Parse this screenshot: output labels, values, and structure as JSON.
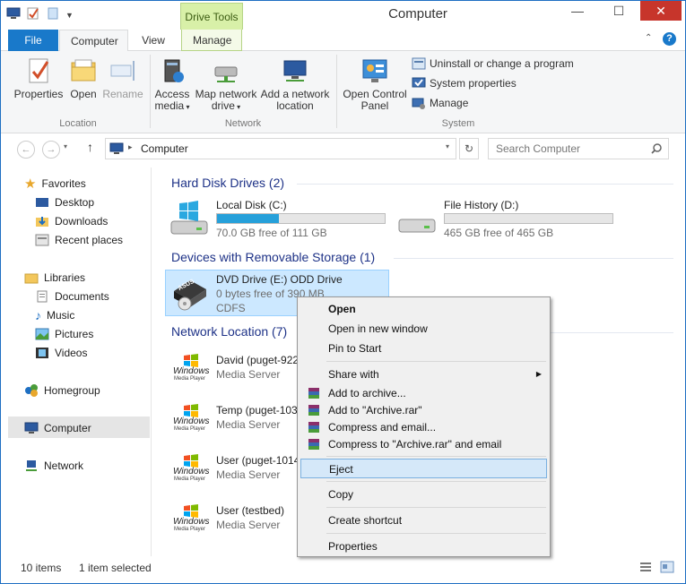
{
  "window": {
    "title": "Computer",
    "context_tab": "Drive Tools",
    "minimize": "—",
    "maximize": "☐",
    "close": "✕"
  },
  "tabs": {
    "file": "File",
    "computer": "Computer",
    "view": "View",
    "manage": "Manage"
  },
  "ribbon": {
    "location": {
      "label": "Location",
      "properties": "Properties",
      "open": "Open",
      "rename": "Rename"
    },
    "network": {
      "label": "Network",
      "access_media_1": "Access",
      "access_media_2": "media",
      "map_drive_1": "Map network",
      "map_drive_2": "drive",
      "add_location_1": "Add a network",
      "add_location_2": "location"
    },
    "system": {
      "label": "System",
      "control_panel_1": "Open Control",
      "control_panel_2": "Panel",
      "uninstall": "Uninstall or change a program",
      "system_properties": "System properties",
      "manage": "Manage"
    }
  },
  "address": {
    "path": "Computer",
    "search_placeholder": "Search Computer"
  },
  "nav": {
    "favorites": "Favorites",
    "desktop": "Desktop",
    "downloads": "Downloads",
    "recent": "Recent places",
    "libraries": "Libraries",
    "documents": "Documents",
    "music": "Music",
    "pictures": "Pictures",
    "videos": "Videos",
    "homegroup": "Homegroup",
    "computer": "Computer",
    "network": "Network"
  },
  "sections": {
    "hdd": "Hard Disk Drives (2)",
    "removable": "Devices with Removable Storage (1)",
    "netloc": "Network Location (7)"
  },
  "drives": [
    {
      "name": "Local Disk (C:)",
      "free": "70.0 GB free of 111 GB",
      "used_fraction": 0.37
    },
    {
      "name": "File History (D:)",
      "free": "465 GB free of 465 GB",
      "used_fraction": 0.0
    }
  ],
  "dvd": {
    "name": "DVD Drive (E:) ODD Drive",
    "free": "0 bytes free of 390 MB",
    "fs": "CDFS",
    "logo": "ASUS"
  },
  "network_items": [
    {
      "name": "David (puget-922",
      "type": "Media Server",
      "logo": "Windows",
      "sublogo": "Media Player"
    },
    {
      "name": "Temp (puget-103",
      "type": "Media Server",
      "logo": "Windows",
      "sublogo": "Media Player"
    },
    {
      "name": "User (puget-1014",
      "type": "Media Server",
      "logo": "Windows",
      "sublogo": "Media Player"
    },
    {
      "name": "User (testbed)",
      "type": "Media Server",
      "logo": "Windows",
      "sublogo": "Media Player"
    }
  ],
  "status": {
    "items": "10 items",
    "selected": "1 item selected"
  },
  "menu": {
    "open": "Open",
    "open_new": "Open in new window",
    "pin": "Pin to Start",
    "share": "Share with",
    "add_archive": "Add to archive...",
    "add_rar": "Add to \"Archive.rar\"",
    "compress_email": "Compress and email...",
    "compress_rar_email": "Compress to \"Archive.rar\" and email",
    "eject": "Eject",
    "copy": "Copy",
    "shortcut": "Create shortcut",
    "properties": "Properties"
  }
}
